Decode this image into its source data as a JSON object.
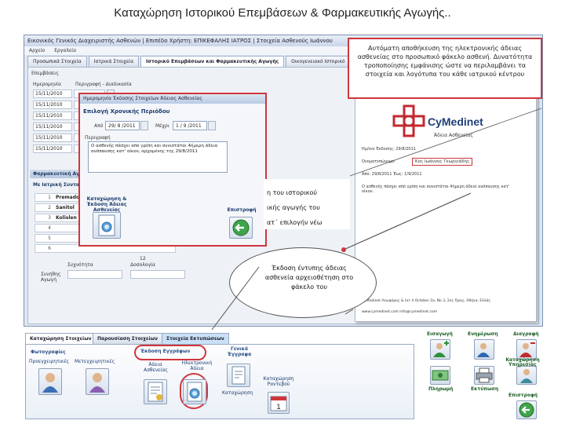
{
  "slide_title": "Καταχώρηση Ιστορικού Επεμβάσεων & Φαρμακευτικής Αγωγής..",
  "app": {
    "window_title": "Εικονικός Γενικός Διαχειριστής Ασθενών | Επιπέδο Χρήστη: ΕΠΙΚΕΦΑΛΗΣ ΙΑΤΡΟΣ | Στοιχεία Ασθενούς Ιωάννου",
    "menu": [
      "Αρχείο",
      "Εργαλεία"
    ],
    "tabs": [
      "Προσωπικά Στοιχεία",
      "Ιατρικά Στοιχεία",
      "Ιστορικό Επεμβάσεων και Φαρμακευτικής Αγωγής",
      "Οικογενειακό Ιστορικό"
    ],
    "labels": {
      "epemvaseis": "Επεμβάσεις",
      "imerominia": "Ημερομηνία",
      "perigrafi": "Περιγραφή - Διαδικασία",
      "farmakeftiki": "Φαρμακευτική Αγωγή",
      "me_iatriki": "Με Ιατρική Συνταγή",
      "syxnotita": "Συχνότητα",
      "dosologia": "Δοσολογία",
      "synithis": "Συνήθης Αγωγή"
    },
    "dates": [
      "15/11/2010",
      "15/11/2010",
      "15/11/2010",
      "15/11/2010",
      "15/11/2010",
      "15/11/2010"
    ],
    "medications": [
      {
        "num": "1",
        "name": "Premadol"
      },
      {
        "num": "2",
        "name": "Sanitol"
      },
      {
        "num": "3",
        "name": "Kolislen"
      },
      {
        "num": "4",
        "name": ""
      },
      {
        "num": "5",
        "name": ""
      },
      {
        "num": "6",
        "name": ""
      }
    ],
    "row_numbers": [
      "10",
      "11",
      "12"
    ]
  },
  "dialog": {
    "title": "Ημερομηνία Έκδοσης Στοιχείων Άδειας Ασθενείας",
    "section_period": "Επιλογή Χρονικής Περιόδου",
    "from_label": "Από",
    "from_value": "29/ 8 /2011",
    "to_label": "Μέχρι",
    "to_value": "1 / 9 /2011",
    "description_label": "Περιγραφή",
    "description_text": "Ο ασθενής πάσχει από γρίπη και συνιστάται 4ήμερη άδεια ανάπαυσης κατ' οίκον, αρχομένης της 29/8/2011",
    "btn_issue_label": "Καταχώρηση & Έκδοση Άδειας Ασθενείας",
    "btn_back_label": "Επιστροφή"
  },
  "callouts": {
    "top": "Αυτόματη αποθήκευση της ηλεκτρονικής άδειας ασθενείας στο προσωπικό φάκελο ασθενή. Δυνατότητα τροποποίησης εμφάνισης ώστε να περιλαμβάνει τα στοιχεία και λογότυπα του κάθε ιατρικού κέντρου",
    "mid_line1": "η του ιστορικού",
    "mid_line2": "ικής αγωγής του",
    "mid_line3": "ατ΄ επιλογήν νέω",
    "oval": "Έκδοση έντυπης άδειας ασθενεία αρχειοθέτηση στο φάκελο του"
  },
  "preview": {
    "logo": "CyMedinet",
    "doc_title": "Άδεια Ασθενείας",
    "row1_label": "Ημ/νια Έκδοσης: 29/8/2011",
    "row2_label": "Ονοματεπώνυμο:",
    "row2_value": "Κος Ιωάννης Γεωργιάδης",
    "row3_label": "Από: 29/8/2011   Έως: 1/9/2011",
    "body": "Ο ασθενής πάσχει από γρίπη και συνιστάται 4ήμερη άδεια ανάπαυσης κατ' οίκον.",
    "footer1": "CyMedinet Λεωφόρος & Ιατ 4 October 2a, Νο 3, 2ος Όρος, Αθήνα, Ελλάς",
    "footer2": "www.cymedinet.com  info@cymedinet.com"
  },
  "bottom": {
    "tabs": [
      "Καταχώρηση Στοιχείων",
      "Παρουσίαση Στοιχείων",
      "Στοιχεία Εκτυπώσεων"
    ],
    "group_photos": "Φωτογραφίες",
    "btn_preop": "Προεγχειρητικές",
    "btn_postop": "Μετεγχειρητικές",
    "group_issue": "Έκδοση Εγγράφων",
    "btn_adeia": "Άδεια Ασθενείας",
    "btn_electronic": "Ηλεκτρονική Άδεια",
    "group_general": "Γενικά Έγγραφα",
    "btn_katachorisi": "Καταχώρηση",
    "btn_rantevou": "Καταχώρηση Ραντεβού",
    "act_eisagogi": "Εισαγωγή",
    "act_enimerosi": "Ενημέρωση",
    "act_diagrafi": "Διαγραφή",
    "act_pliromi": "Πληρωμή",
    "act_ektyposi": "Εκτύπωση",
    "act_ypiresia": "Καταχώρηση Υπηρεσίας",
    "act_epistrofi": "Επιστροφή"
  }
}
